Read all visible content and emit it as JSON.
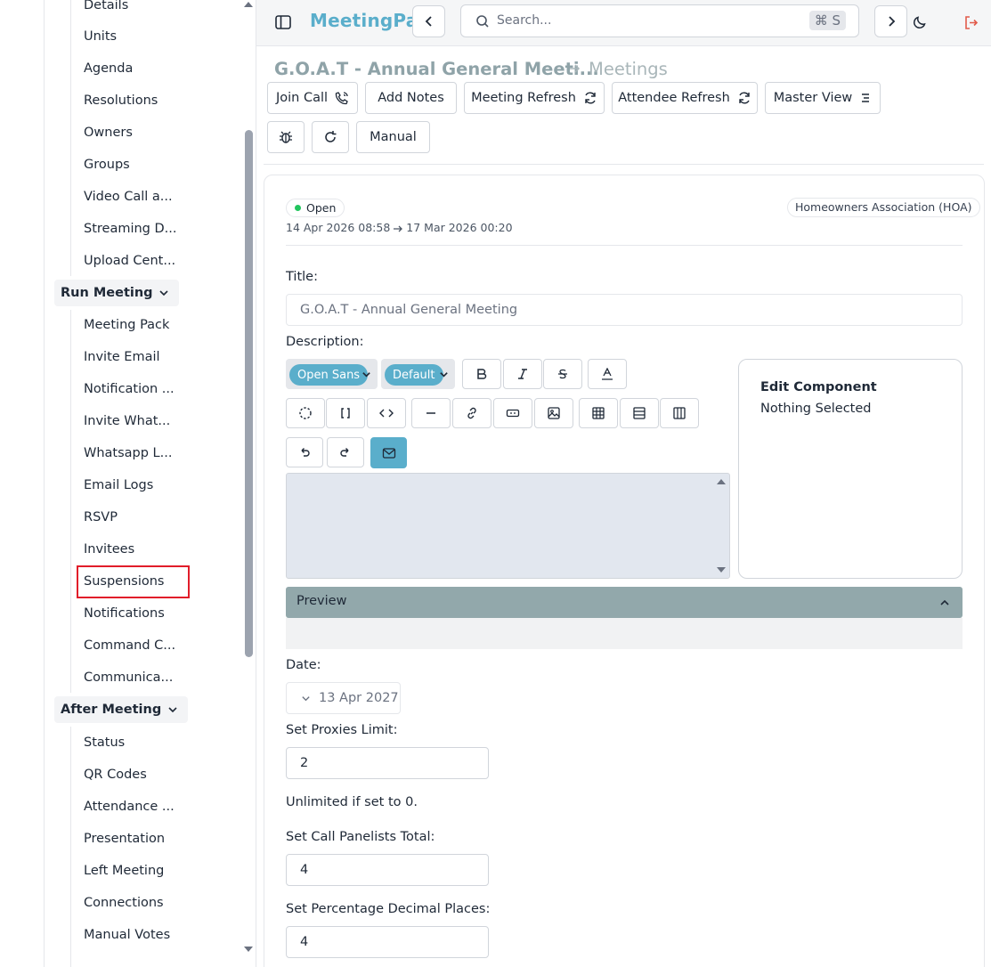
{
  "sidebar": {
    "items_top": [
      "Details",
      "Units",
      "Agenda",
      "Resolutions",
      "Owners",
      "Groups",
      "Video Call a...",
      "Streaming D...",
      "Upload Cent..."
    ],
    "group_run": "Run Meeting",
    "items_run": [
      "Meeting Pack",
      "Invite Email",
      "Notification ...",
      "Invite What...",
      "Whatsapp L...",
      "Email Logs",
      "RSVP",
      "Invitees",
      "Suspensions",
      "Notifications",
      "Command C...",
      "Communica..."
    ],
    "group_after": "After Meeting",
    "items_after": [
      "Status",
      "QR Codes",
      "Attendance ...",
      "Presentation",
      "Left Meeting",
      "Connections",
      "Manual Votes"
    ],
    "highlighted_item": "Suspensions"
  },
  "topbar": {
    "brand": "MeetingPal",
    "search_placeholder": "Search...",
    "search_shortcut": "⌘ S"
  },
  "header": {
    "title": "G.O.A.T - Annual General Meeti...",
    "section": "Meetings",
    "buttons": {
      "join_call": "Join Call",
      "add_notes": "Add Notes",
      "meeting_refresh": "Meeting Refresh",
      "attendee_refresh": "Attendee Refresh",
      "master_view": "Master View",
      "manual": "Manual"
    }
  },
  "card": {
    "status": "Open",
    "status_color": "#22c55e",
    "start": "14 Apr 2026 08:58",
    "end": "17 Mar 2026 00:20",
    "org_type": "Homeowners Association (HOA)",
    "title_label": "Title:",
    "title_value": "G.O.A.T - Annual General Meeting",
    "description_label": "Description:",
    "font_pill": "Open Sans",
    "size_pill": "Default",
    "edit_component_title": "Edit Component",
    "edit_component_text": "Nothing Selected",
    "preview_label": "Preview",
    "date_label": "Date:",
    "date_value": "13 Apr 2027",
    "proxies_label": "Set Proxies Limit:",
    "proxies_value": "2",
    "proxies_help": "Unlimited if set to 0.",
    "panelists_label": "Set Call Panelists Total:",
    "panelists_value": "4",
    "decimals_label": "Set Percentage Decimal Places:",
    "decimals_value": "4"
  },
  "colors": {
    "accent": "#5aaecb",
    "highlight": "#e11d2a",
    "preview_bar": "#92a8ab"
  }
}
